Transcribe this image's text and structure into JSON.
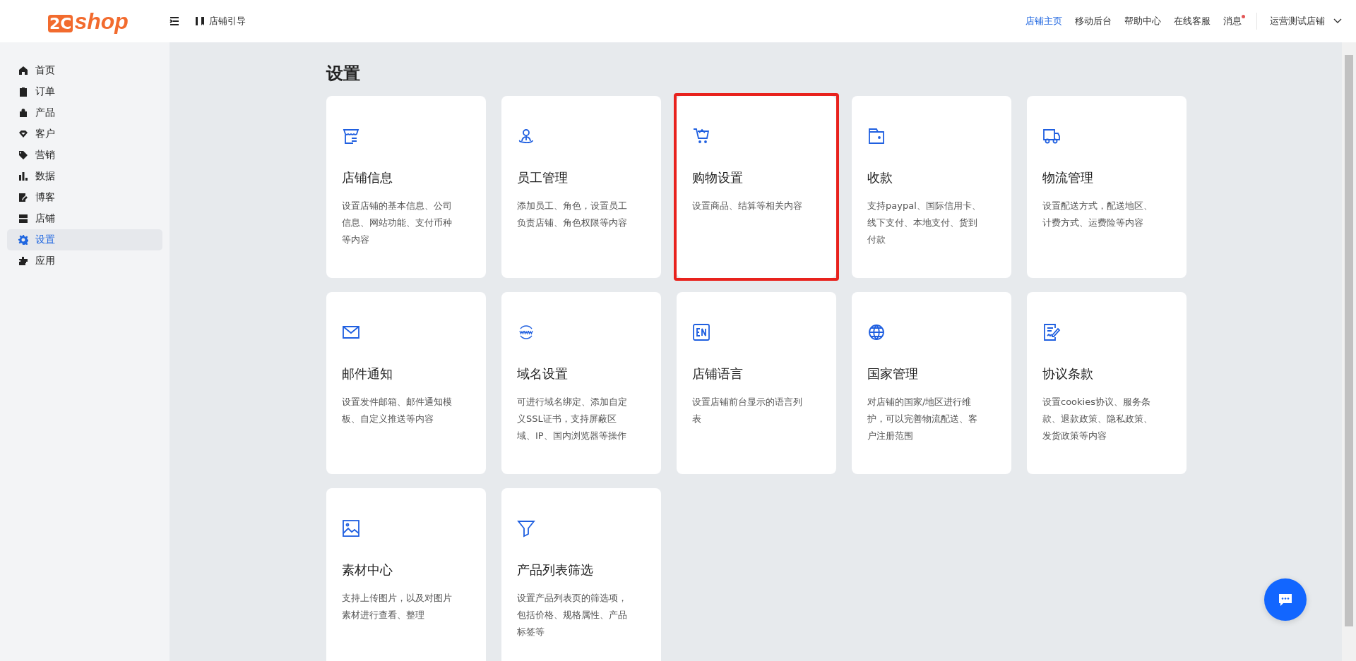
{
  "header": {
    "logo_prefix": "2C",
    "logo_text": "shop",
    "guide": "店铺引导",
    "links": [
      {
        "label": "店铺主页",
        "selected": true
      },
      {
        "label": "移动后台",
        "selected": false
      },
      {
        "label": "帮助中心",
        "selected": false
      },
      {
        "label": "在线客服",
        "selected": false
      },
      {
        "label": "消息",
        "selected": false,
        "unread": true
      }
    ],
    "store": "运营测试店铺"
  },
  "sidebar": {
    "items": [
      {
        "label": "首页",
        "selected": false
      },
      {
        "label": "订单",
        "selected": false
      },
      {
        "label": "产品",
        "selected": false
      },
      {
        "label": "客户",
        "selected": false
      },
      {
        "label": "营销",
        "selected": false
      },
      {
        "label": "数据",
        "selected": false
      },
      {
        "label": "博客",
        "selected": false
      },
      {
        "label": "店铺",
        "selected": false
      },
      {
        "label": "设置",
        "selected": true
      },
      {
        "label": "应用",
        "selected": false
      }
    ]
  },
  "page": {
    "title": "设置",
    "cards": [
      {
        "title": "店铺信息",
        "description": "设置店铺的基本信息、公司信息、网站功能、支付币种等内容",
        "highlighted": false
      },
      {
        "title": "员工管理",
        "description": "添加员工、角色，设置员工负责店铺、角色权限等内容",
        "highlighted": false
      },
      {
        "title": "购物设置",
        "description": "设置商品、结算等相关内容",
        "highlighted": true
      },
      {
        "title": "收款",
        "description": "支持paypal、国际信用卡、线下支付、本地支付、货到付款",
        "highlighted": false
      },
      {
        "title": "物流管理",
        "description": "设置配送方式，配送地区、计费方式、运费险等内容",
        "highlighted": false
      },
      {
        "title": "邮件通知",
        "description": "设置发件邮箱、邮件通知模板、自定义推送等内容",
        "highlighted": false
      },
      {
        "title": "域名设置",
        "description": "可进行域名绑定、添加自定义SSL证书，支持屏蔽区域、IP、国内浏览器等操作",
        "highlighted": false
      },
      {
        "title": "店铺语言",
        "description": "设置店铺前台显示的语言列表",
        "highlighted": false
      },
      {
        "title": "国家管理",
        "description": "对店铺的国家/地区进行维护，可以完善物流配送、客户注册范围",
        "highlighted": false
      },
      {
        "title": "协议条款",
        "description": "设置cookies协议、服务条款、退款政策、隐私政策、发货政策等内容",
        "highlighted": false
      },
      {
        "title": "素材中心",
        "description": "支持上传图片，以及对图片素材进行查看、整理",
        "highlighted": false
      },
      {
        "title": "产品列表筛选",
        "description": "设置产品列表页的筛选项，包括价格、规格属性、产品标签等",
        "highlighted": false
      }
    ]
  }
}
